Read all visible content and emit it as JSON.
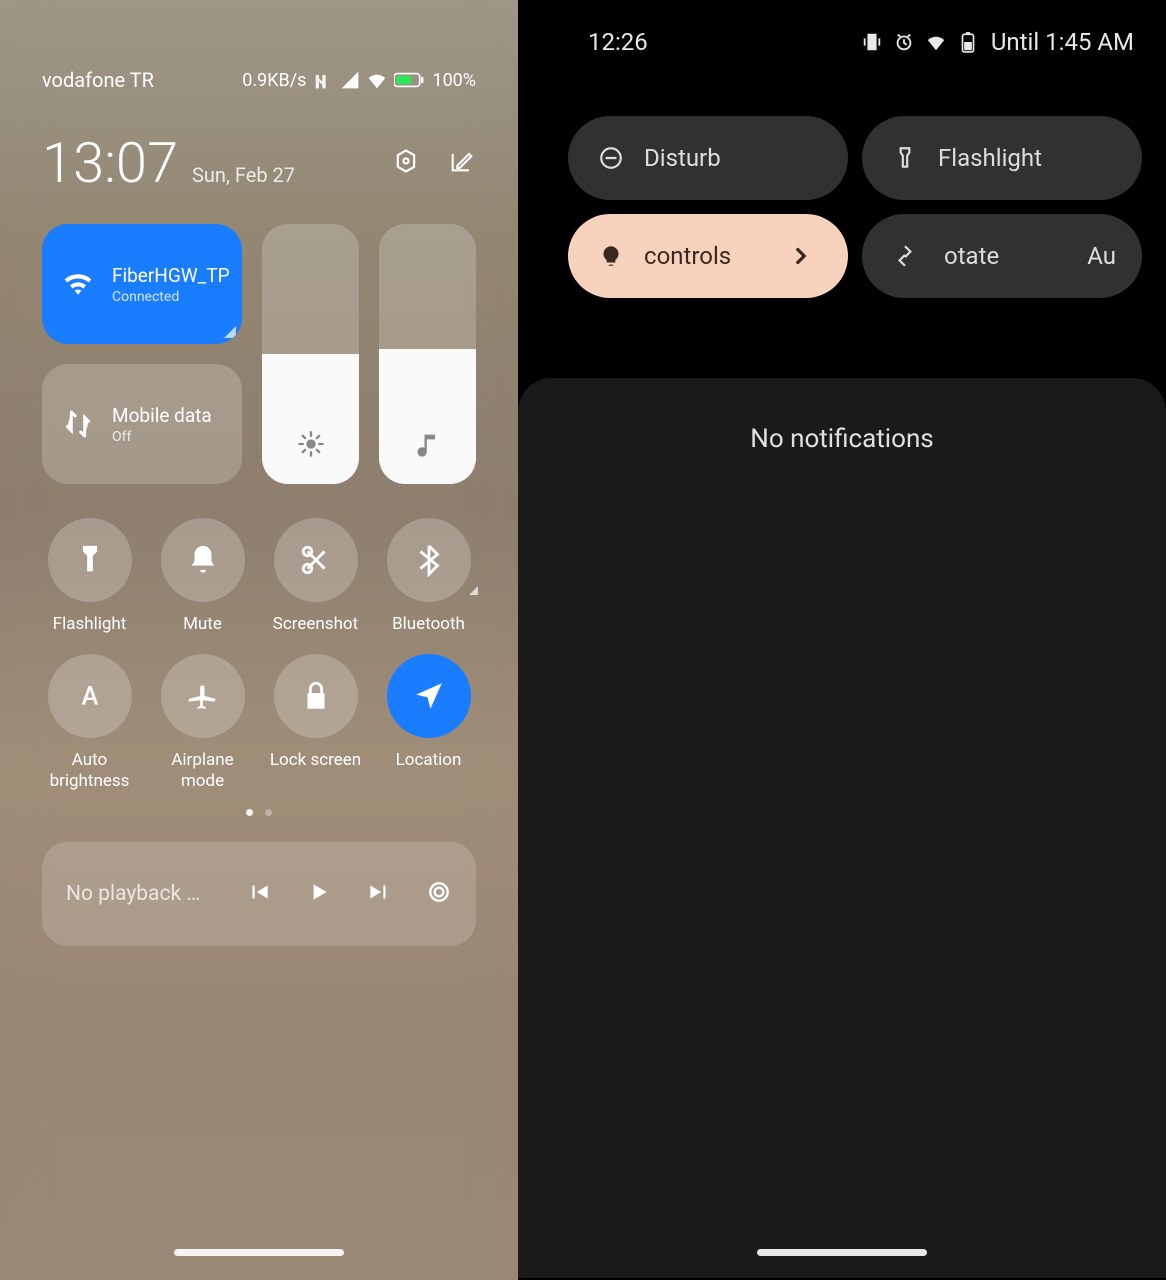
{
  "left": {
    "status": {
      "carrier": "vodafone TR",
      "speed": "0.9KB/s",
      "battery_pct": "100%"
    },
    "header": {
      "time": "13:07",
      "date": "Sun, Feb 27"
    },
    "wifi": {
      "label": "FiberHGW_TP",
      "status": "Connected"
    },
    "data": {
      "label": "Mobile data",
      "status": "Off"
    },
    "sliders": {
      "brightness_pct": 50,
      "volume_pct": 52
    },
    "toggles": [
      {
        "id": "flashlight",
        "label": "Flashlight",
        "active": false
      },
      {
        "id": "mute",
        "label": "Mute",
        "active": false
      },
      {
        "id": "screenshot",
        "label": "Screenshot",
        "active": false
      },
      {
        "id": "bluetooth",
        "label": "Bluetooth",
        "active": false,
        "expandable": true
      },
      {
        "id": "autobright",
        "label": "Auto\nbrightness",
        "active": false
      },
      {
        "id": "airplane",
        "label": "Airplane\nmode",
        "active": false
      },
      {
        "id": "lockscreen",
        "label": "Lock screen",
        "active": false
      },
      {
        "id": "location",
        "label": "Location",
        "active": true
      }
    ],
    "media": {
      "label": "No playback …"
    }
  },
  "right": {
    "status": {
      "time": "12:26",
      "battery_until": "Until 1:45 AM"
    },
    "pills": {
      "dnd": "Disturb",
      "flashlight": "Flashlight",
      "controls": "controls",
      "rotate_a": "otate",
      "rotate_b": "Au"
    },
    "notifications": {
      "empty": "No notifications"
    }
  }
}
